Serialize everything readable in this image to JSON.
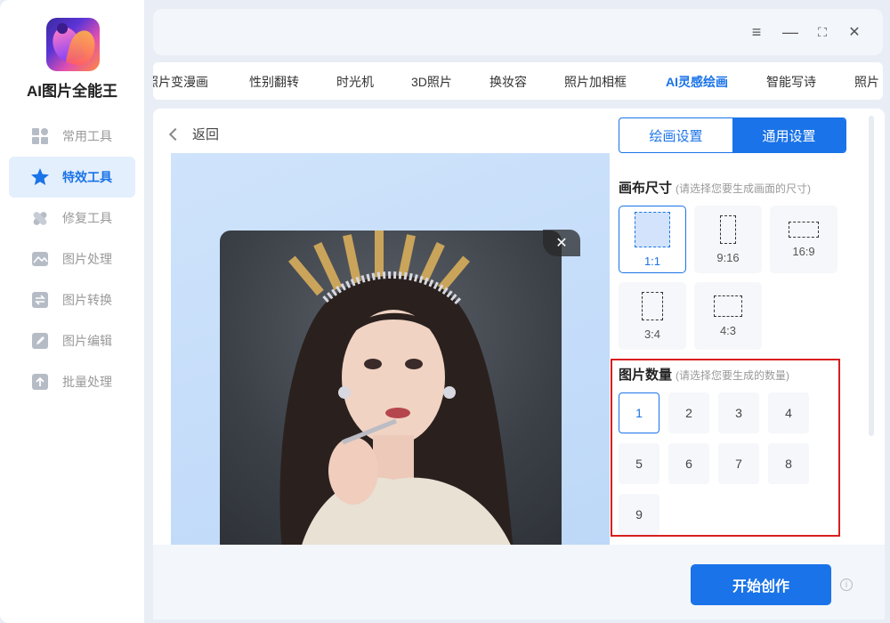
{
  "app": {
    "title": "AI图片全能王"
  },
  "sidebar": {
    "items": [
      {
        "label": "常用工具",
        "icon": "grid-icon",
        "active": false
      },
      {
        "label": "特效工具",
        "icon": "star-icon",
        "active": true
      },
      {
        "label": "修复工具",
        "icon": "bandage-icon",
        "active": false
      },
      {
        "label": "图片处理",
        "icon": "image-icon",
        "active": false
      },
      {
        "label": "图片转换",
        "icon": "convert-icon",
        "active": false
      },
      {
        "label": "图片编辑",
        "icon": "edit-icon",
        "active": false
      },
      {
        "label": "批量处理",
        "icon": "upload-icon",
        "active": false
      }
    ]
  },
  "window": {
    "menu": "≡",
    "minimize": "—",
    "maximize": "⛶",
    "close": "✕"
  },
  "tabs": [
    {
      "label": "照片变漫画"
    },
    {
      "label": "性别翻转"
    },
    {
      "label": "时光机"
    },
    {
      "label": "3D照片"
    },
    {
      "label": "换妆容"
    },
    {
      "label": "照片加相框"
    },
    {
      "label": "AI灵感绘画",
      "active": true
    },
    {
      "label": "智能写诗"
    },
    {
      "label": "照片"
    }
  ],
  "main": {
    "back_label": "返回",
    "preview_close": "✕",
    "settings_tabs": {
      "draw": "绘画设置",
      "general": "通用设置"
    },
    "canvas": {
      "title": "画布尺寸",
      "hint": "(请选择您要生成画面的尺寸)",
      "ratios": [
        "1:1",
        "9:16",
        "16:9",
        "3:4",
        "4:3"
      ],
      "selected": "1:1"
    },
    "count": {
      "title": "图片数量",
      "hint": "(请选择您要生成的数量)",
      "options": [
        "1",
        "2",
        "3",
        "4",
        "5",
        "6",
        "7",
        "8",
        "9"
      ],
      "selected": "1"
    },
    "start_button": "开始创作",
    "info": "i"
  },
  "colors": {
    "accent": "#1a73e8",
    "highlight_box": "#d81e1e"
  }
}
